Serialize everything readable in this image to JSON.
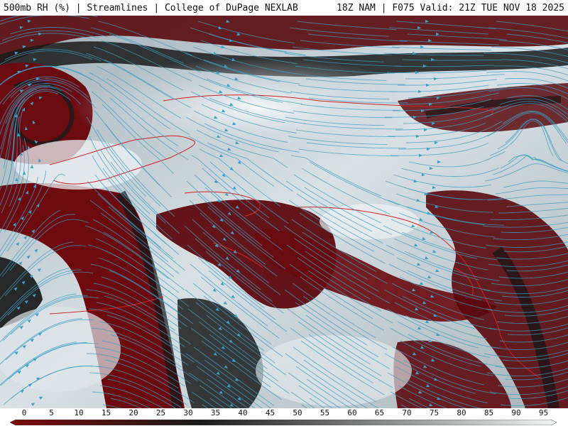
{
  "header": {
    "left_title": "500mb RH (%) | Streamlines | College of DuPage NEXLAB",
    "right_title": "18Z NAM | F075 Valid: 21Z TUE NOV 18 2025"
  },
  "legend": {
    "ticks": [
      "0",
      "5",
      "10",
      "15",
      "20",
      "25",
      "30",
      "35",
      "40",
      "45",
      "50",
      "55",
      "60",
      "65",
      "70",
      "75",
      "80",
      "85",
      "90",
      "95"
    ],
    "colors": {
      "dry": "#7a0a0a",
      "mid": "#1b1b1b",
      "moist": "#f2f4f5"
    }
  },
  "map": {
    "streamline_color": "#3a9fc9",
    "coastline_color": "#d42020",
    "dry_color": "#6e0c10",
    "dark_color": "#151515",
    "moist_color": "#c8d3d8"
  }
}
